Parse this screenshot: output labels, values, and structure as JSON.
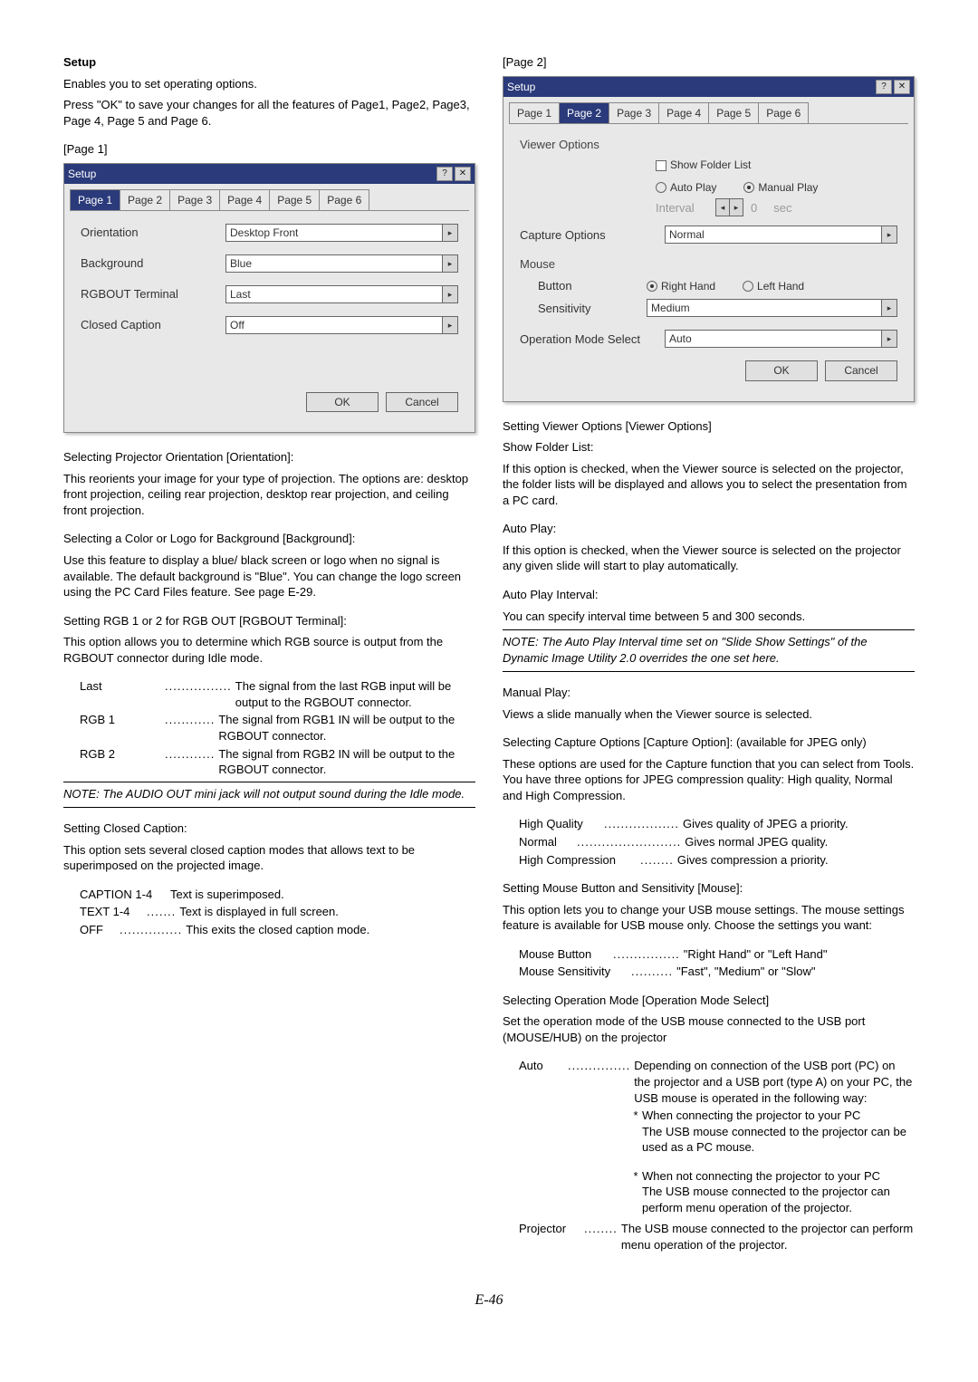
{
  "pageNumber": "E-46",
  "left": {
    "heading": "Setup",
    "intro1": "Enables you to set operating options.",
    "intro2": "Press \"OK\" to save your changes for all the features of Page1, Page2, Page3, Page 4, Page 5 and Page 6.",
    "page1": "[Page 1]",
    "dlg1": {
      "title": "Setup",
      "tabs": [
        "Page 1",
        "Page 2",
        "Page 3",
        "Page 4",
        "Page 5",
        "Page 6"
      ],
      "activeTab": 0,
      "rows": {
        "orientation": {
          "label": "Orientation",
          "value": "Desktop Front"
        },
        "background": {
          "label": "Background",
          "value": "Blue"
        },
        "rgbout": {
          "label": "RGBOUT Terminal",
          "value": "Last"
        },
        "cc": {
          "label": "Closed Caption",
          "value": "Off"
        }
      },
      "ok": "OK",
      "cancel": "Cancel"
    },
    "orientHead": "Selecting Projector Orientation [Orientation]:",
    "orientBody": "This reorients your image for your type of projection. The options are: desktop front projection, ceiling rear projection, desktop rear projection, and ceiling front projection.",
    "bgHead": "Selecting a Color or Logo for Background [Background]:",
    "bgBody": "Use this feature to display a blue/ black screen or logo when no signal is available. The default background is \"Blue\". You can change the logo screen using the PC Card Files feature. See page E-29.",
    "rgboutHead": "Setting RGB 1 or 2 for RGB OUT [RGBOUT Terminal]:",
    "rgboutBody": "This option allows you to determine which RGB source is output from the RGBOUT connector during Idle mode.",
    "rgboutList": [
      {
        "term": "Last",
        "def": "The signal from the last RGB input will be output to the RGBOUT connector."
      },
      {
        "term": "RGB 1",
        "def": "The signal from RGB1 IN will be output to the RGBOUT connector."
      },
      {
        "term": "RGB 2",
        "def": "The signal from RGB2 IN will be output to the RGBOUT connector."
      }
    ],
    "note1": "NOTE: The AUDIO OUT mini jack will not output sound during the Idle mode.",
    "ccHead": "Setting Closed Caption:",
    "ccBody": "This option sets several closed caption modes that allows text to be superimposed on the projected image.",
    "ccList": [
      {
        "term": "CAPTION 1-4",
        "def": "Text is superimposed."
      },
      {
        "term": "TEXT 1-4",
        "def": "Text is displayed in full screen."
      },
      {
        "term": "OFF",
        "def": "This exits the closed caption mode."
      }
    ]
  },
  "right": {
    "page2": "[Page 2]",
    "dlg2": {
      "title": "Setup",
      "tabs": [
        "Page 1",
        "Page 2",
        "Page 3",
        "Page 4",
        "Page 5",
        "Page 6"
      ],
      "activeTab": 1,
      "viewerSection": "Viewer Options",
      "showFolder": "Show Folder List",
      "autoPlay": "Auto Play",
      "manualPlay": "Manual Play",
      "intervalLabel": "Interval",
      "intervalVal": "0",
      "intervalUnit": "sec",
      "captureLabel": "Capture Options",
      "captureVal": "Normal",
      "mouseSection": "Mouse",
      "buttonLabel": "Button",
      "right": "Right Hand",
      "leftHand": "Left Hand",
      "sensLabel": "Sensitivity",
      "sensVal": "Medium",
      "opModeLabel": "Operation Mode Select",
      "opModeVal": "Auto",
      "ok": "OK",
      "cancel": "Cancel"
    },
    "voHead": "Setting Viewer Options [Viewer Options]",
    "sflHead": "Show Folder List:",
    "sflBody": "If this option is checked, when the Viewer source is selected on the projector, the folder lists will be displayed and allows you to select the presentation from a PC card.",
    "apHead": "Auto Play:",
    "apBody": "If this option is checked, when the Viewer source is selected on the projector any given slide will start to play automatically.",
    "apiHead": "Auto Play Interval:",
    "apiBody": "You can specify interval time between 5 and 300 seconds.",
    "note2": "NOTE: The Auto Play Interval time set on \"Slide Show Settings\" of the Dynamic Image Utility 2.0 overrides the one set here.",
    "mpHead": "Manual Play:",
    "mpBody": "Views a slide manually when the Viewer source is selected.",
    "capHead": "Selecting Capture Options [Capture Option]: (available for JPEG only)",
    "capBody": "These options are used for the Capture function that you can select from Tools. You have three options for JPEG compression quality: High quality, Normal and High Compression.",
    "capList": [
      {
        "term": "High Quality",
        "def": "Gives quality of JPEG a priority."
      },
      {
        "term": "Normal",
        "def": "Gives normal JPEG quality."
      },
      {
        "term": "High Compression",
        "def": "Gives compression a priority."
      }
    ],
    "mouseHead": "Setting Mouse Button and Sensitivity [Mouse]:",
    "mouseBody": "This option lets you to change your USB mouse settings. The mouse settings feature is available for USB mouse only. Choose the settings you want:",
    "mouseList": [
      {
        "term": "Mouse Button",
        "def": "\"Right Hand\" or \"Left Hand\""
      },
      {
        "term": "Mouse Sensitivity",
        "def": "\"Fast\", \"Medium\" or \"Slow\""
      }
    ],
    "opHead": "Selecting Operation Mode [Operation Mode Select]",
    "opBody": "Set the operation mode of the USB mouse connected to the USB port (MOUSE/HUB) on the projector",
    "opList": {
      "auto": {
        "term": "Auto",
        "def": "Depending on connection of the USB port (PC) on the projector and a USB port (type A) on your PC, the USB mouse is operated in the following way:"
      },
      "b1h": "When connecting the projector to your PC",
      "b1b": "The USB mouse connected to the projector can be used as a PC mouse.",
      "b2h": "When not connecting the projector to your PC",
      "b2b": "The USB mouse connected to the projector can perform menu operation of the projector.",
      "proj": {
        "term": "Projector",
        "def": "The USB mouse connected to the projector can perform menu operation of the projector."
      }
    }
  }
}
